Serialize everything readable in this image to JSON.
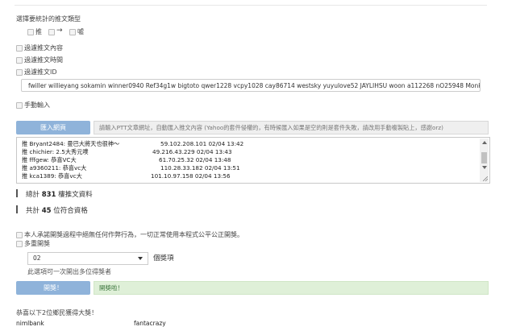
{
  "top": {
    "section_title": "選擇要統計的推文類型",
    "types": [
      {
        "label": "推",
        "checked": true
      },
      {
        "label": "→",
        "checked": true
      },
      {
        "label": "噓",
        "checked": false
      }
    ]
  },
  "filters": {
    "content": "過濾推文內容",
    "time": "過濾推文時間",
    "id": "過濾推文ID"
  },
  "id_input": {
    "value": "fwiller willieyang sokamin winner0940 Ref34g1w bigtoto qwer1228 vcpy1028 cay86714 westsky yuyulove52 JAYLIHSU woon a112268 nO25948 MonkeyMoney chichier julia"
  },
  "manual_input": "手動輸入",
  "import_button": "匯入網頁",
  "hint": "請輸入PTT文章網址，自動匯入推文內容 (Yahoo的套件侵權的，有時候匯入如果是空的則是套件失敗，請改用手動複製貼上，感謝orz)",
  "push_rows": [
    {
      "text": "推 Bryant2484: 曼巴大將天也很神～",
      "ip": "59.102.208.101 02/04 13:42"
    },
    {
      "text": "推 chichier: 2.5大秀元噗",
      "ip": "49.216.43.229 02/04 13:43"
    },
    {
      "text": "推 fffgew: 恭喜VC大",
      "ip": "61.70.25.32 02/04 13:48"
    },
    {
      "text": "推 a9360211: 恭喜vc大",
      "ip": "110.28.33.182 02/04 13:51"
    },
    {
      "text": "推 kca1389: 恭喜vc大",
      "ip": "101.10.97.158 02/04 13:56"
    }
  ],
  "stats": {
    "total_prefix": "總計",
    "total_value": "831",
    "total_suffix": "樓推文資料",
    "qualified_prefix": "共計",
    "qualified_value": "45",
    "qualified_suffix": "位符合資格"
  },
  "options": {
    "agree": "本人承諾開獎過程中絕無任何作弊行為，一切正常使用本程式公平公正開獎。",
    "multi_prize": "多重開獎"
  },
  "prize_select": {
    "value": "02",
    "suffix": "個獎項",
    "note": "此選項可一次開出多位得獎者"
  },
  "draw_button": "開獎！",
  "success_msg": "開獎啦！",
  "winners_title": "恭喜以下2位鄉民獲得大獎！",
  "winners": [
    "nimlbank",
    "fantacrazy"
  ]
}
